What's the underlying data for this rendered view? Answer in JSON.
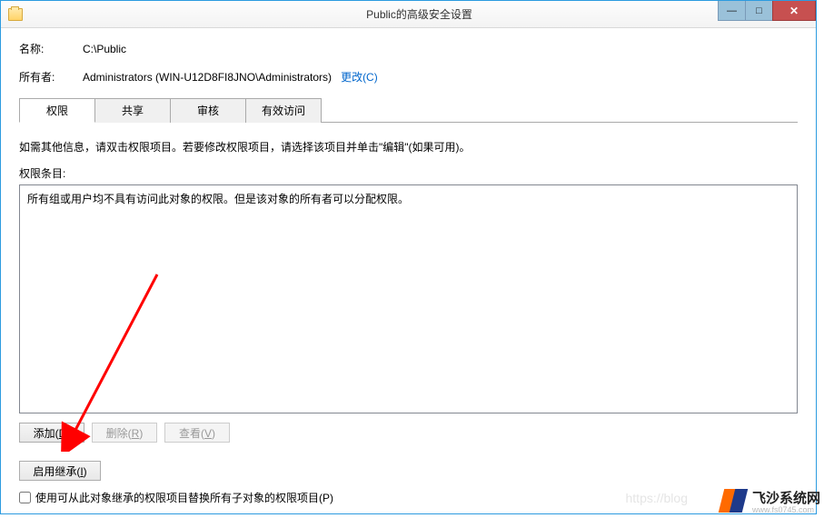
{
  "window": {
    "title": "Public的高级安全设置",
    "minimize_glyph": "—",
    "maximize_glyph": "□",
    "close_glyph": "✕"
  },
  "info": {
    "name_label": "名称:",
    "name_value": "C:\\Public",
    "owner_label": "所有者:",
    "owner_value": "Administrators (WIN-U12D8FI8JNO\\Administrators)",
    "change_link": "更改(C)"
  },
  "tabs": {
    "permissions": "权限",
    "share": "共享",
    "audit": "审核",
    "effective": "有效访问"
  },
  "section": {
    "instructions": "如需其他信息，请双击权限项目。若要修改权限项目，请选择该项目并单击\"编辑\"(如果可用)。",
    "entries_label": "权限条目:",
    "entries_msg": "所有组或用户均不具有访问此对象的权限。但是该对象的所有者可以分配权限。"
  },
  "buttons": {
    "add": "添加(D)",
    "add_key": "D",
    "remove": "删除(R)",
    "remove_key": "R",
    "view": "查看(V)",
    "view_key": "V",
    "inherit": "启用继承(I)",
    "inherit_key": "I"
  },
  "checkbox": {
    "replace_label": "使用可从此对象继承的权限项目替换所有子对象的权限项目(P)"
  },
  "watermark": {
    "blog": "https://blog",
    "logo_text": "飞沙系统网",
    "logo_sub": "www.fs0745.com"
  }
}
